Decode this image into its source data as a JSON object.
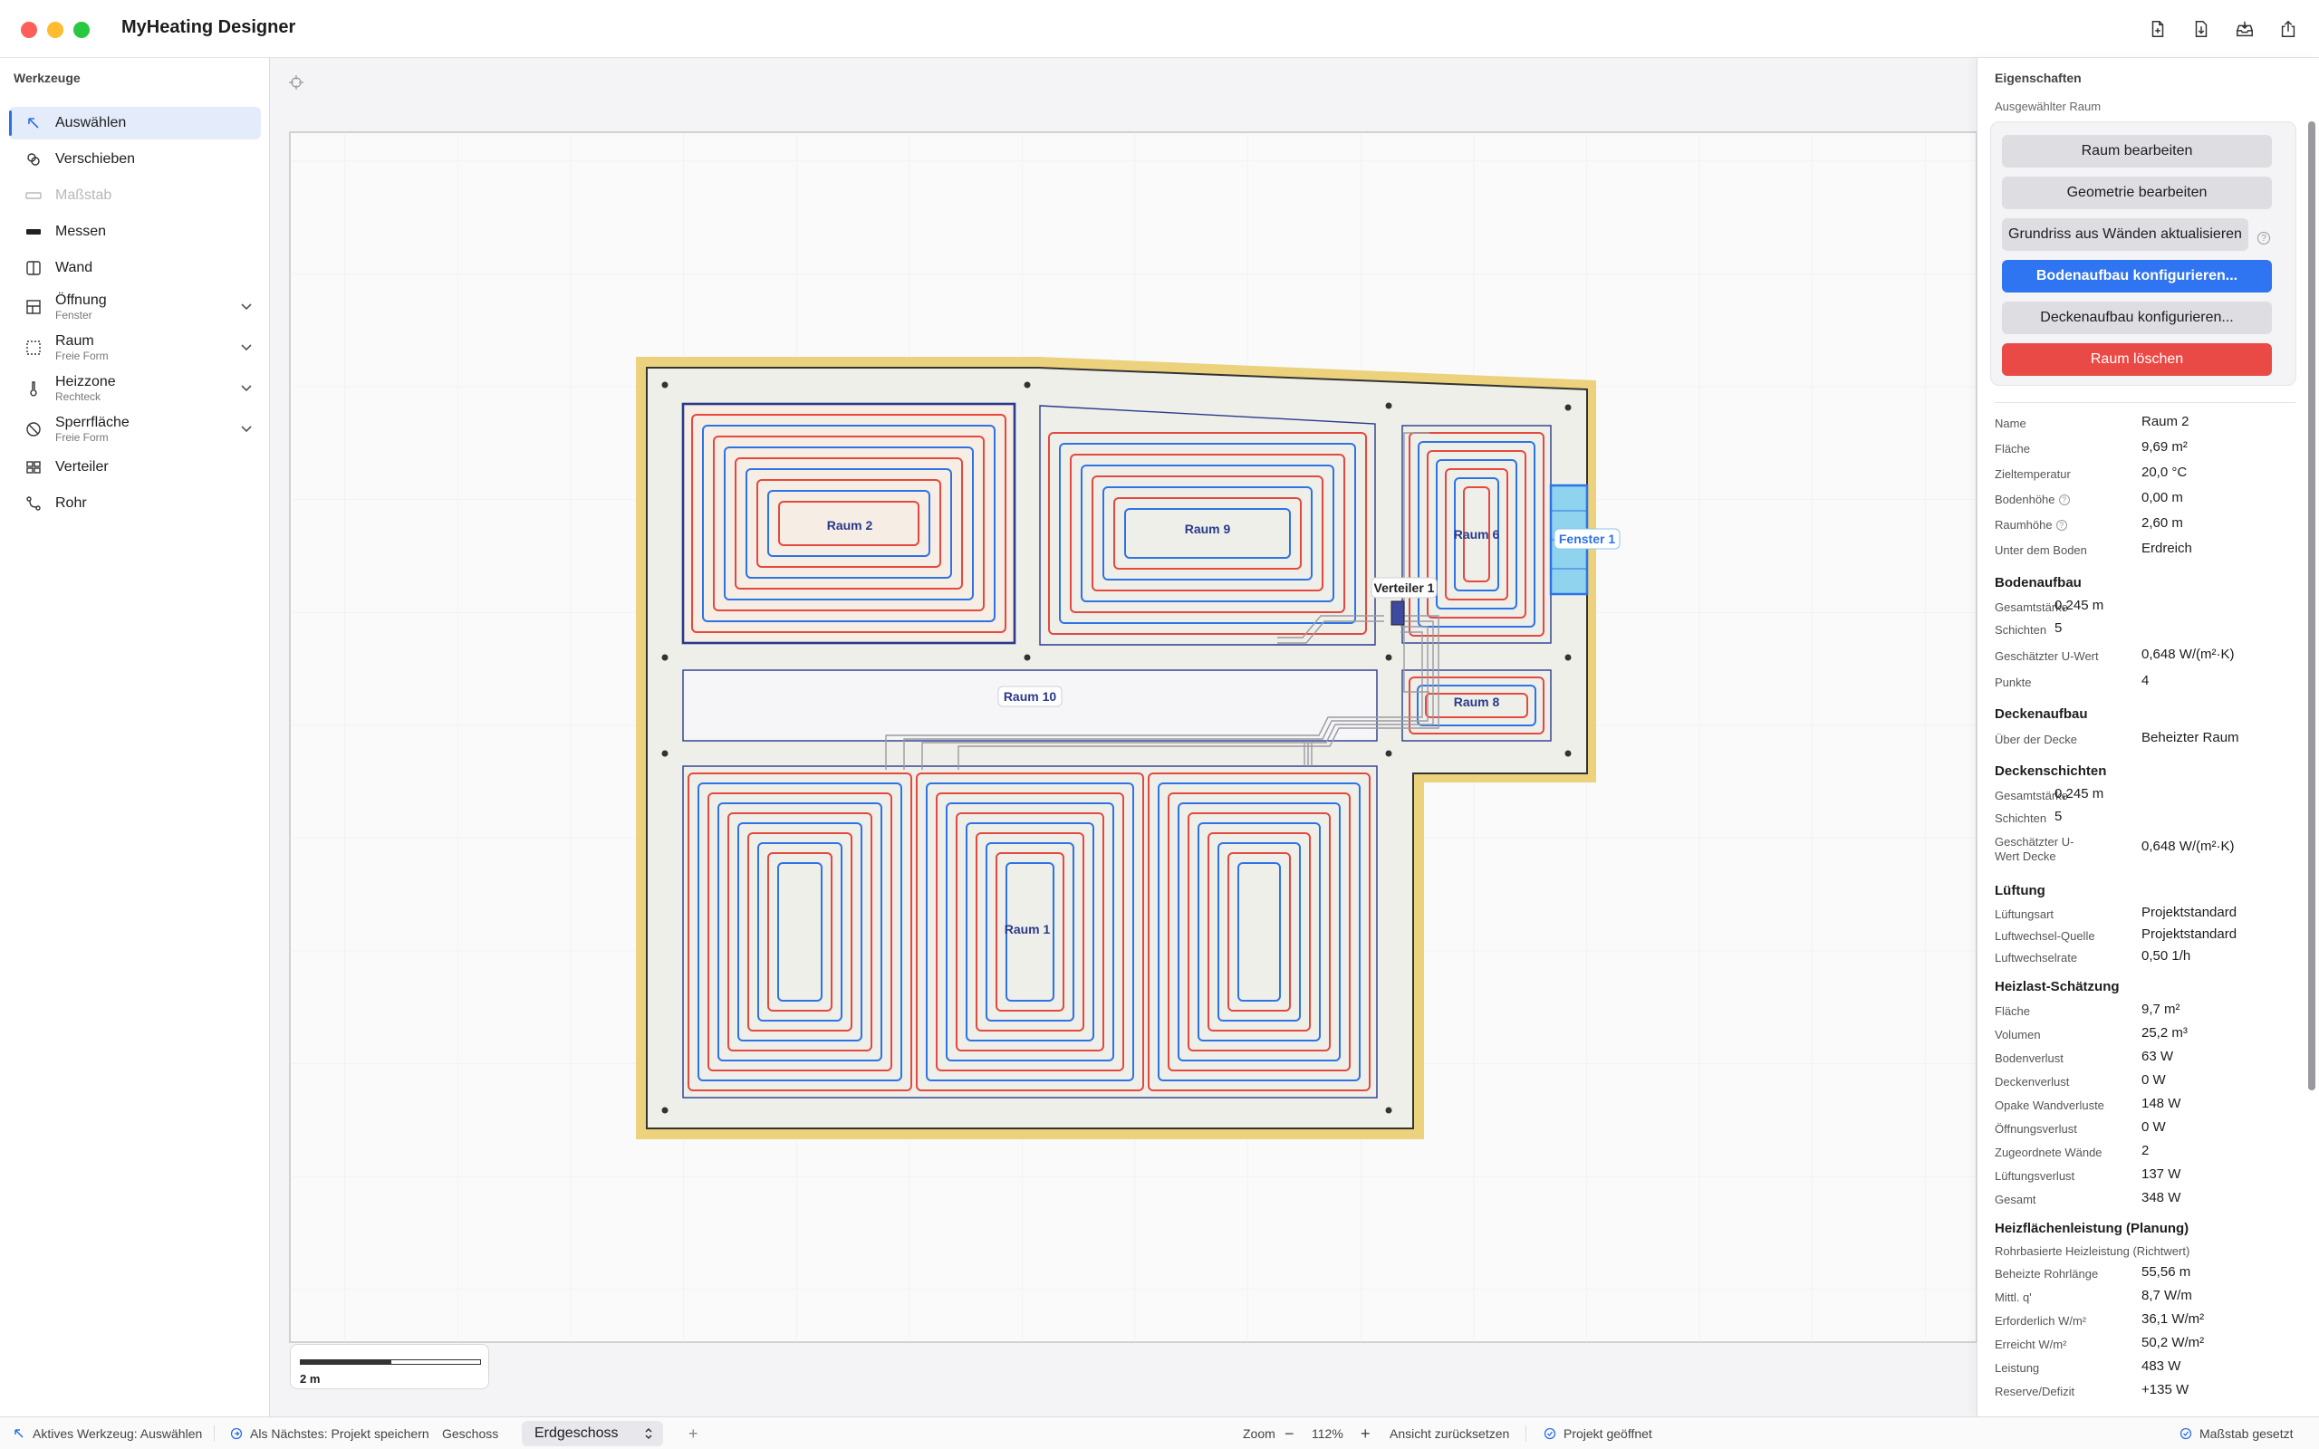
{
  "app": {
    "title": "MyHeating Designer"
  },
  "toolbar": {
    "buttons": [
      "new-document-icon",
      "import-icon",
      "download-icon",
      "share-icon"
    ]
  },
  "sidebar": {
    "heading": "Werkzeuge",
    "tools": [
      {
        "label": "Auswählen",
        "icon": "select-arrow-icon",
        "active": true
      },
      {
        "label": "Verschieben",
        "icon": "move-icon"
      },
      {
        "label": "Maßstab",
        "icon": "ruler-icon",
        "disabled": true
      },
      {
        "label": "Messen",
        "icon": "measure-icon"
      },
      {
        "label": "Wand",
        "icon": "wall-icon"
      },
      {
        "label": "Öffnung",
        "sub": "Fenster",
        "icon": "opening-icon"
      },
      {
        "label": "Raum",
        "sub": "Freie Form",
        "icon": "room-icon"
      },
      {
        "label": "Heizzone",
        "sub": "Rechteck",
        "icon": "thermometer-icon"
      },
      {
        "label": "Sperrfläche",
        "sub": "Freie Form",
        "icon": "blocked-icon"
      },
      {
        "label": "Verteiler",
        "icon": "distributor-icon"
      },
      {
        "label": "Rohr",
        "icon": "pipe-icon"
      }
    ]
  },
  "plan": {
    "rooms": {
      "raum2": "Raum 2",
      "raum9": "Raum 9",
      "raum6": "Raum 6",
      "raum10": "Raum 10",
      "raum8": "Raum 8",
      "raum1": "Raum 1"
    },
    "window": "Fenster 1",
    "distributor": "Verteiler 1",
    "scale_label": "2 m",
    "colors": {
      "supply": "#e5483f",
      "return": "#2e73e6",
      "wall": "#ecd27c"
    }
  },
  "panel": {
    "heading": "Eigenschaften",
    "sub": "Ausgewählter Raum",
    "buttons": {
      "edit_room": "Raum bearbeiten",
      "edit_geometry": "Geometrie bearbeiten",
      "update_outline": "Grundriss aus Wänden aktualisieren",
      "config_floor": "Bodenaufbau konfigurieren...",
      "config_ceiling": "Deckenaufbau konfigurieren...",
      "delete_room": "Raum löschen"
    },
    "general": {
      "name_k": "Name",
      "name_v": "Raum 2",
      "area_k": "Fläche",
      "area_v": "9,69 m²",
      "temp_k": "Zieltemperatur",
      "temp_v": "20,0 °C",
      "floorh_k": "Bodenhöhe",
      "floorh_v": "0,00 m",
      "roomh_k": "Raumhöhe",
      "roomh_v": "2,60 m",
      "below_k": "Unter dem Boden",
      "below_v": "Erdreich"
    },
    "floor": {
      "title": "Bodenaufbau",
      "thick_k": "Gesamtstärke",
      "thick_v": "0,245 m",
      "layers_k": "Schichten",
      "layers_v": "5",
      "u_k": "Geschätzter U-Wert",
      "u_v": "0,648 W/(m²·K)",
      "points_k": "Punkte",
      "points_v": "4"
    },
    "ceiling": {
      "title": "Deckenaufbau",
      "above_k": "Über der Decke",
      "above_v": "Beheizter Raum"
    },
    "ceiling_layers": {
      "title": "Deckenschichten",
      "thick_k": "Gesamtstärke",
      "thick_v": "0,245 m",
      "layers_k": "Schichten",
      "layers_v": "5",
      "u_k1": "Geschätzter U-",
      "u_k2": "Wert Decke",
      "u_v": "0,648 W/(m²·K)"
    },
    "ventilation": {
      "title": "Lüftung",
      "type_k": "Lüftungsart",
      "type_v": "Projektstandard",
      "src_k": "Luftwechsel-Quelle",
      "src_v": "Projektstandard",
      "rate_k": "Luftwechselrate",
      "rate_v": "0,50 1/h"
    },
    "heatload": {
      "title": "Heizlast-Schätzung",
      "area_k": "Fläche",
      "area_v": "9,7 m²",
      "vol_k": "Volumen",
      "vol_v": "25,2 m³",
      "floorloss_k": "Bodenverlust",
      "floorloss_v": "63 W",
      "ceilloss_k": "Deckenverlust",
      "ceilloss_v": "0 W",
      "wall_k": "Opake Wandverluste",
      "wall_v": "148 W",
      "open_k": "Öffnungsverlust",
      "open_v": "0 W",
      "walls_k": "Zugeordnete Wände",
      "walls_v": "2",
      "vent_k": "Lüftungsverlust",
      "vent_v": "137 W",
      "total_k": "Gesamt",
      "total_v": "348 W"
    },
    "surface": {
      "title": "Heizflächenleistung (Planung)",
      "subtitle": "Rohrbasierte Heizleistung (Richtwert)",
      "len_k": "Beheizte Rohrlänge",
      "len_v": "55,56 m",
      "q_k": "Mittl. q'",
      "q_v": "8,7 W/m",
      "req_k": "Erforderlich W/m²",
      "req_v": "36,1 W/m²",
      "ach_k": "Erreicht W/m²",
      "ach_v": "50,2 W/m²",
      "pow_k": "Leistung",
      "pow_v": "483 W",
      "res_k": "Reserve/Defizit",
      "res_v": "+135 W"
    }
  },
  "status": {
    "active_tool": "Aktives Werkzeug: Auswählen",
    "next": "Als Nächstes: Projekt speichern",
    "floor_label": "Geschoss",
    "floor_value": "Erdgeschoss",
    "add": "+",
    "zoom_label": "Zoom",
    "zoom_minus": "−",
    "zoom_value": "112%",
    "zoom_plus": "+",
    "reset_view": "Ansicht zurücksetzen",
    "project_opened": "Projekt geöffnet",
    "scale_set": "Maßstab gesetzt"
  }
}
